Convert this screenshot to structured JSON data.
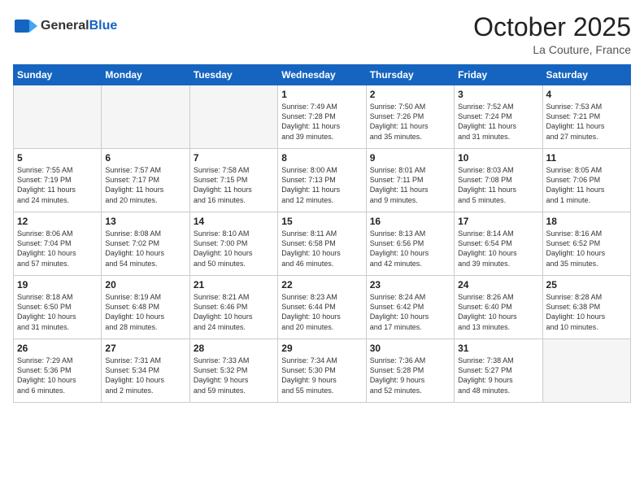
{
  "logo": {
    "general": "General",
    "blue": "Blue"
  },
  "header": {
    "month": "October 2025",
    "location": "La Couture, France"
  },
  "weekdays": [
    "Sunday",
    "Monday",
    "Tuesday",
    "Wednesday",
    "Thursday",
    "Friday",
    "Saturday"
  ],
  "weeks": [
    [
      {
        "day": "",
        "info": ""
      },
      {
        "day": "",
        "info": ""
      },
      {
        "day": "",
        "info": ""
      },
      {
        "day": "1",
        "info": "Sunrise: 7:49 AM\nSunset: 7:28 PM\nDaylight: 11 hours\nand 39 minutes."
      },
      {
        "day": "2",
        "info": "Sunrise: 7:50 AM\nSunset: 7:26 PM\nDaylight: 11 hours\nand 35 minutes."
      },
      {
        "day": "3",
        "info": "Sunrise: 7:52 AM\nSunset: 7:24 PM\nDaylight: 11 hours\nand 31 minutes."
      },
      {
        "day": "4",
        "info": "Sunrise: 7:53 AM\nSunset: 7:21 PM\nDaylight: 11 hours\nand 27 minutes."
      }
    ],
    [
      {
        "day": "5",
        "info": "Sunrise: 7:55 AM\nSunset: 7:19 PM\nDaylight: 11 hours\nand 24 minutes."
      },
      {
        "day": "6",
        "info": "Sunrise: 7:57 AM\nSunset: 7:17 PM\nDaylight: 11 hours\nand 20 minutes."
      },
      {
        "day": "7",
        "info": "Sunrise: 7:58 AM\nSunset: 7:15 PM\nDaylight: 11 hours\nand 16 minutes."
      },
      {
        "day": "8",
        "info": "Sunrise: 8:00 AM\nSunset: 7:13 PM\nDaylight: 11 hours\nand 12 minutes."
      },
      {
        "day": "9",
        "info": "Sunrise: 8:01 AM\nSunset: 7:11 PM\nDaylight: 11 hours\nand 9 minutes."
      },
      {
        "day": "10",
        "info": "Sunrise: 8:03 AM\nSunset: 7:08 PM\nDaylight: 11 hours\nand 5 minutes."
      },
      {
        "day": "11",
        "info": "Sunrise: 8:05 AM\nSunset: 7:06 PM\nDaylight: 11 hours\nand 1 minute."
      }
    ],
    [
      {
        "day": "12",
        "info": "Sunrise: 8:06 AM\nSunset: 7:04 PM\nDaylight: 10 hours\nand 57 minutes."
      },
      {
        "day": "13",
        "info": "Sunrise: 8:08 AM\nSunset: 7:02 PM\nDaylight: 10 hours\nand 54 minutes."
      },
      {
        "day": "14",
        "info": "Sunrise: 8:10 AM\nSunset: 7:00 PM\nDaylight: 10 hours\nand 50 minutes."
      },
      {
        "day": "15",
        "info": "Sunrise: 8:11 AM\nSunset: 6:58 PM\nDaylight: 10 hours\nand 46 minutes."
      },
      {
        "day": "16",
        "info": "Sunrise: 8:13 AM\nSunset: 6:56 PM\nDaylight: 10 hours\nand 42 minutes."
      },
      {
        "day": "17",
        "info": "Sunrise: 8:14 AM\nSunset: 6:54 PM\nDaylight: 10 hours\nand 39 minutes."
      },
      {
        "day": "18",
        "info": "Sunrise: 8:16 AM\nSunset: 6:52 PM\nDaylight: 10 hours\nand 35 minutes."
      }
    ],
    [
      {
        "day": "19",
        "info": "Sunrise: 8:18 AM\nSunset: 6:50 PM\nDaylight: 10 hours\nand 31 minutes."
      },
      {
        "day": "20",
        "info": "Sunrise: 8:19 AM\nSunset: 6:48 PM\nDaylight: 10 hours\nand 28 minutes."
      },
      {
        "day": "21",
        "info": "Sunrise: 8:21 AM\nSunset: 6:46 PM\nDaylight: 10 hours\nand 24 minutes."
      },
      {
        "day": "22",
        "info": "Sunrise: 8:23 AM\nSunset: 6:44 PM\nDaylight: 10 hours\nand 20 minutes."
      },
      {
        "day": "23",
        "info": "Sunrise: 8:24 AM\nSunset: 6:42 PM\nDaylight: 10 hours\nand 17 minutes."
      },
      {
        "day": "24",
        "info": "Sunrise: 8:26 AM\nSunset: 6:40 PM\nDaylight: 10 hours\nand 13 minutes."
      },
      {
        "day": "25",
        "info": "Sunrise: 8:28 AM\nSunset: 6:38 PM\nDaylight: 10 hours\nand 10 minutes."
      }
    ],
    [
      {
        "day": "26",
        "info": "Sunrise: 7:29 AM\nSunset: 5:36 PM\nDaylight: 10 hours\nand 6 minutes."
      },
      {
        "day": "27",
        "info": "Sunrise: 7:31 AM\nSunset: 5:34 PM\nDaylight: 10 hours\nand 2 minutes."
      },
      {
        "day": "28",
        "info": "Sunrise: 7:33 AM\nSunset: 5:32 PM\nDaylight: 9 hours\nand 59 minutes."
      },
      {
        "day": "29",
        "info": "Sunrise: 7:34 AM\nSunset: 5:30 PM\nDaylight: 9 hours\nand 55 minutes."
      },
      {
        "day": "30",
        "info": "Sunrise: 7:36 AM\nSunset: 5:28 PM\nDaylight: 9 hours\nand 52 minutes."
      },
      {
        "day": "31",
        "info": "Sunrise: 7:38 AM\nSunset: 5:27 PM\nDaylight: 9 hours\nand 48 minutes."
      },
      {
        "day": "",
        "info": ""
      }
    ]
  ]
}
